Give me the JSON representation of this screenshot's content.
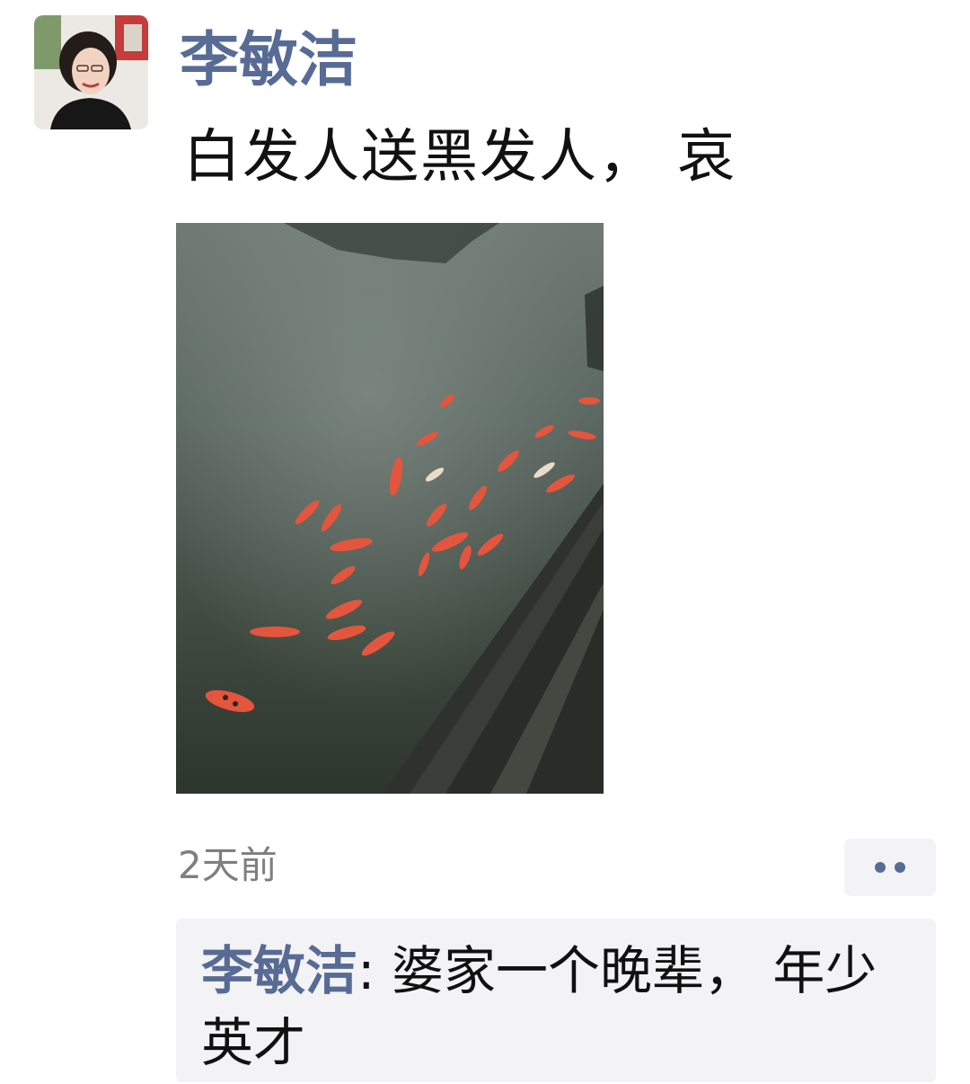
{
  "post": {
    "author": "李敏洁",
    "text": "白发人送黑发人， 哀",
    "timestamp": "2天前",
    "image_description_icon": "goldfish-pond-photo"
  },
  "comments": [
    {
      "author": "李敏洁",
      "separator": ": ",
      "text": "婆家一个晚辈， 年少英才"
    }
  ],
  "colors": {
    "name_link": "#576b95",
    "body_text": "#111111",
    "timestamp": "#7f7f7f",
    "panel_bg": "#f3f3f5"
  },
  "icons": {
    "more": "more-dots-icon",
    "avatar": "avatar"
  }
}
